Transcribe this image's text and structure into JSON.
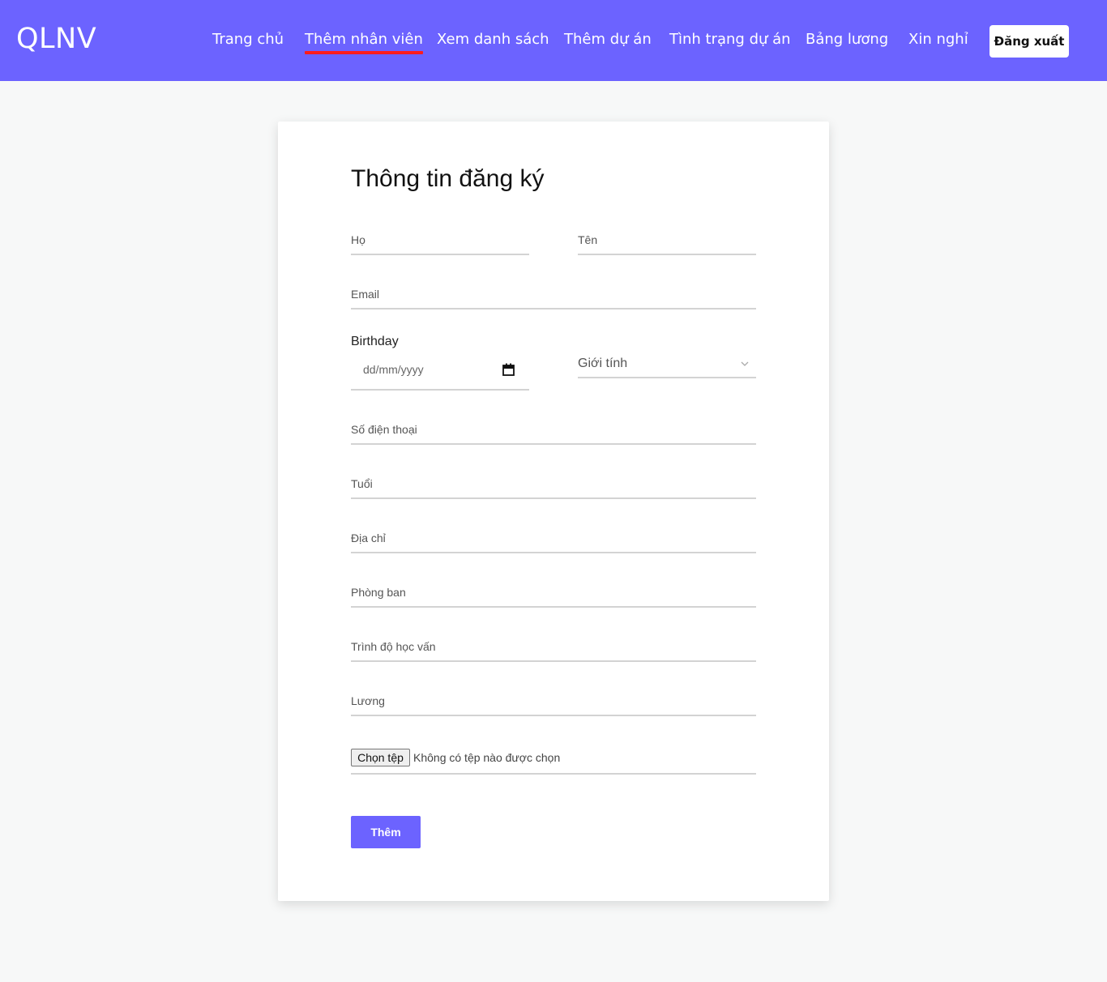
{
  "brand": "QLNV",
  "nav": {
    "items": [
      {
        "label": "Trang chủ"
      },
      {
        "label": "Thêm nhân viên"
      },
      {
        "label": "Xem danh sách"
      },
      {
        "label": "Thêm dự án"
      },
      {
        "label": "Tình trạng dự án"
      },
      {
        "label": "Bảng lương"
      },
      {
        "label": "Xin nghỉ"
      }
    ],
    "active_index": 1,
    "logout_label": "Đăng xuất"
  },
  "form": {
    "title": "Thông tin đăng ký",
    "last_name_label": "Họ",
    "first_name_label": "Tên",
    "email_label": "Email",
    "birthday_label": "Birthday",
    "birthday_placeholder": "dd/mm/yyyy",
    "gender_label": "Giới tính",
    "phone_label": "Số điện thoại",
    "age_label": "Tuổi",
    "address_label": "Địa chỉ",
    "department_label": "Phòng ban",
    "education_label": "Trình độ học vấn",
    "salary_label": "Lương",
    "file_button_label": "Chọn tệp",
    "file_status": "Không có tệp nào được chọn",
    "submit_label": "Thêm"
  },
  "colors": {
    "primary": "#6c63ff",
    "active_underline": "#ff1c1c"
  },
  "icons": {
    "birthday_picker": "calendar-icon",
    "gender_dropdown": "chevron-down-icon"
  }
}
